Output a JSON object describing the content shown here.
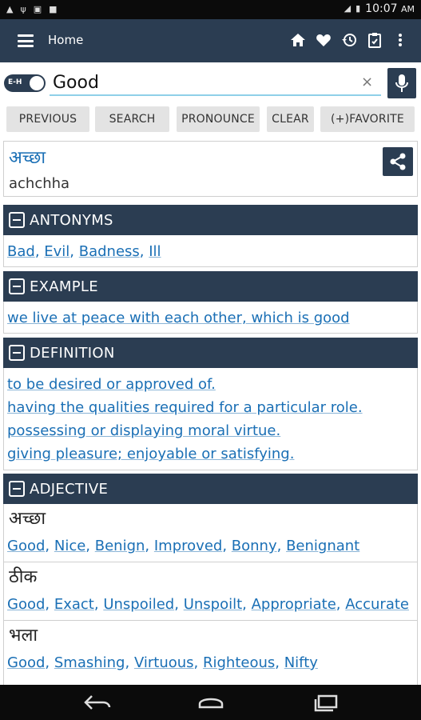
{
  "status_bar": {
    "time": "10:07",
    "period": "AM",
    "icons": [
      "warning-icon",
      "wifi-icon",
      "image-icon",
      "square-icon",
      "signal-icon",
      "battery-icon"
    ]
  },
  "app_bar": {
    "title": "Home",
    "actions": [
      "home-icon",
      "heart-icon",
      "history-icon",
      "clipboard-icon",
      "overflow-menu-icon"
    ]
  },
  "search": {
    "toggle_label": "E-H",
    "value": "Good",
    "clear_glyph": "×"
  },
  "buttons": {
    "previous": "PREVIOUS",
    "search": "SEARCH",
    "pronounce": "PRONOUNCE",
    "clear": "CLEAR",
    "favorite": "(+)FAVORITE"
  },
  "result": {
    "hindi": "अच्छा",
    "transliteration": "achchha"
  },
  "sections": {
    "antonyms": {
      "title": "ANTONYMS",
      "words": [
        "Bad",
        "Evil",
        "Badness",
        "Ill"
      ]
    },
    "example": {
      "title": "EXAMPLE",
      "sentence": "we live at peace with each other, which is good"
    },
    "definition": {
      "title": "DEFINITION",
      "lines": [
        "to be desired or approved of.",
        "having the qualities required for a particular role.",
        "possessing or displaying moral virtue.",
        "giving pleasure; enjoyable or satisfying."
      ]
    },
    "adjective": {
      "title": "ADJECTIVE",
      "entries": [
        {
          "word": "अच्छा",
          "synonyms": [
            "Good",
            "Nice",
            "Benign",
            "Improved",
            "Bonny",
            "Benignant"
          ]
        },
        {
          "word": "ठीक",
          "synonyms": [
            "Good",
            "Exact",
            "Unspoiled",
            "Unspoilt",
            "Appropriate",
            "Accurate"
          ]
        },
        {
          "word": "भला",
          "synonyms": [
            "Good",
            "Smashing",
            "Virtuous",
            "Righteous",
            "Nifty"
          ]
        }
      ]
    }
  },
  "colors": {
    "app_bar": "#2b3d52",
    "link": "#1a6fb5",
    "button_bg": "#e3e3e3",
    "search_underline": "#8fd0e8"
  }
}
